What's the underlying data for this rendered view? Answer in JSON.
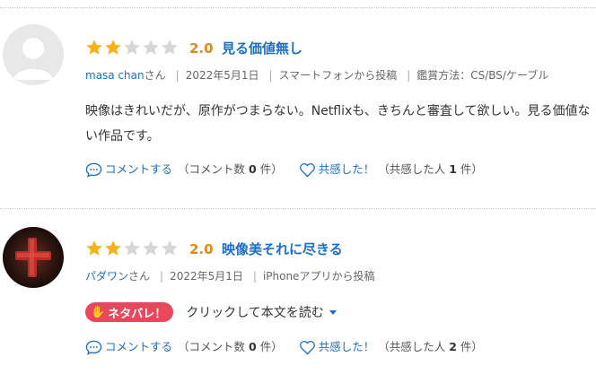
{
  "reviews": [
    {
      "rating": 2,
      "max_rating": 5,
      "score": "2.0",
      "title": "見る価値無し",
      "user": "masa chan",
      "honorific": "さん",
      "meta": [
        "2022年5月1日",
        "スマートフォンから投稿",
        "鑑賞方法：CS/BS/ケーブル"
      ],
      "body": "映像はきれいだが、原作がつまらない。Netflixも、きちんと審査して欲しい。見る価値ない作品です。",
      "comment_label": "コメントする",
      "comment_count_prefix": "（コメント数",
      "comment_count": "0",
      "comment_count_suffix": "件）",
      "like_label": "共感した！",
      "like_count_prefix": "（共感した人",
      "like_count": "1",
      "like_count_suffix": "件）"
    },
    {
      "rating": 2,
      "max_rating": 5,
      "score": "2.0",
      "title": "映像美それに尽きる",
      "user": "パダワン",
      "honorific": "さん",
      "meta": [
        "2022年5月1日",
        "iPhoneアプリから投稿"
      ],
      "spoiler_badge": "ネタバレ！",
      "spoiler_link": "クリックして本文を読む",
      "comment_label": "コメントする",
      "comment_count_prefix": "（コメント数",
      "comment_count": "0",
      "comment_count_suffix": "件）",
      "like_label": "共感した！",
      "like_count_prefix": "（共感した人",
      "like_count": "2",
      "like_count_suffix": "件）"
    }
  ],
  "colors": {
    "star_filled": "#f5b21b",
    "star_empty": "#d6d6d6",
    "score": "#e28a18",
    "link": "#1c6ec7",
    "spoiler": "#e9475c"
  },
  "icons": {
    "comment": "speech-bubble-icon",
    "like": "heart-icon",
    "spoiler": "hand-icon",
    "expand": "caret-down-icon",
    "avatar_default": "default-user-icon"
  }
}
